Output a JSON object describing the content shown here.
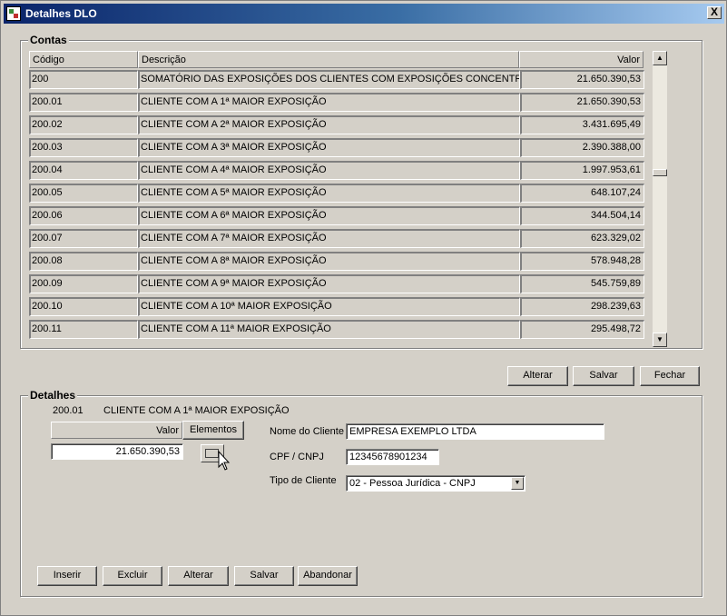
{
  "window": {
    "title": "Detalhes DLO",
    "close_label": "X"
  },
  "contas": {
    "title": "Contas",
    "headers": {
      "codigo": "Código",
      "descricao": "Descrição",
      "valor": "Valor"
    },
    "rows": [
      {
        "codigo": "200",
        "descricao": "SOMATÓRIO DAS EXPOSIÇÕES DOS CLIENTES COM EXPOSIÇÕES CONCENTRADAS",
        "valor": "21.650.390,53"
      },
      {
        "codigo": "200.01",
        "descricao": "CLIENTE COM A 1ª MAIOR EXPOSIÇÃO",
        "valor": "21.650.390,53"
      },
      {
        "codigo": "200.02",
        "descricao": "CLIENTE COM A 2ª MAIOR EXPOSIÇÃO",
        "valor": "3.431.695,49"
      },
      {
        "codigo": "200.03",
        "descricao": "CLIENTE COM A 3ª MAIOR EXPOSIÇÃO",
        "valor": "2.390.388,00"
      },
      {
        "codigo": "200.04",
        "descricao": "CLIENTE COM A 4ª MAIOR EXPOSIÇÃO",
        "valor": "1.997.953,61"
      },
      {
        "codigo": "200.05",
        "descricao": "CLIENTE COM A 5ª MAIOR EXPOSIÇÃO",
        "valor": "648.107,24"
      },
      {
        "codigo": "200.06",
        "descricao": "CLIENTE COM A 6ª MAIOR EXPOSIÇÃO",
        "valor": "344.504,14"
      },
      {
        "codigo": "200.07",
        "descricao": "CLIENTE COM A 7ª MAIOR EXPOSIÇÃO",
        "valor": "623.329,02"
      },
      {
        "codigo": "200.08",
        "descricao": "CLIENTE COM A 8ª MAIOR EXPOSIÇÃO",
        "valor": "578.948,28"
      },
      {
        "codigo": "200.09",
        "descricao": "CLIENTE COM A 9ª MAIOR EXPOSIÇÃO",
        "valor": "545.759,89"
      },
      {
        "codigo": "200.10",
        "descricao": "CLIENTE COM A 10ª MAIOR EXPOSIÇÃO",
        "valor": "298.239,63"
      },
      {
        "codigo": "200.11",
        "descricao": "CLIENTE COM A 11ª MAIOR EXPOSIÇÃO",
        "valor": "295.498,72"
      }
    ],
    "scroll_up": "▲",
    "scroll_down": "▼"
  },
  "top_buttons": {
    "alterar": "Alterar",
    "salvar": "Salvar",
    "fechar": "Fechar"
  },
  "detalhes": {
    "title": "Detalhes",
    "codigo": "200.01",
    "descricao": "CLIENTE COM A 1ª MAIOR EXPOSIÇÃO",
    "valor_header": "Valor",
    "elementos_label": "Elementos",
    "valor": "21.650.390,53",
    "nome_label": "Nome do Cliente",
    "nome_value": "EMPRESA EXEMPLO LTDA",
    "cpf_label": "CPF / CNPJ",
    "cpf_value": "12345678901234",
    "tipo_label": "Tipo de Cliente",
    "tipo_value": "02 - Pessoa Jurídica - CNPJ",
    "combo_arrow": "▼"
  },
  "bottom_buttons": {
    "inserir": "Inserir",
    "excluir": "Excluir",
    "alterar": "Alterar",
    "salvar": "Salvar",
    "abandonar": "Abandonar"
  }
}
